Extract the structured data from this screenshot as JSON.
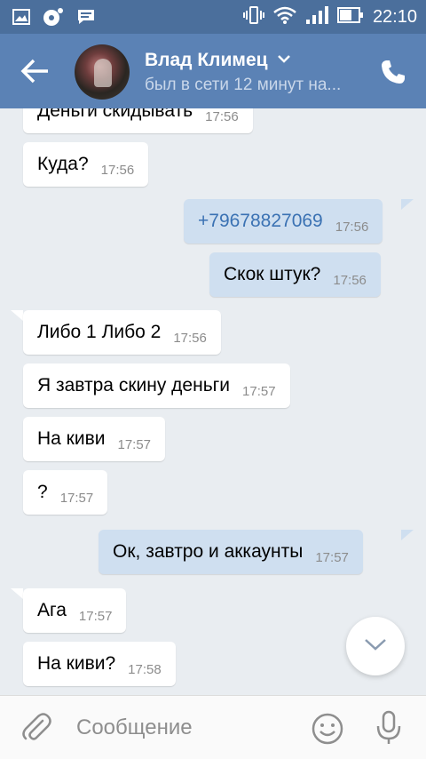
{
  "status_bar": {
    "time": "22:10",
    "icons": [
      "gallery-icon",
      "media-notification-icon",
      "chat-notification-icon",
      "vibrate-icon",
      "wifi-icon",
      "signal-icon",
      "battery-icon"
    ]
  },
  "header": {
    "contact_name": "Влад Климец",
    "last_seen": "был в сети 12 минут на...",
    "icons": [
      "back-arrow-icon",
      "chevron-down-icon",
      "phone-icon"
    ],
    "colors": {
      "header_bg": "#5b82b5",
      "statusbar_bg": "#4b6f9c"
    }
  },
  "messages": [
    {
      "direction": "in",
      "text": "Деньги скидывать",
      "time": "17:56"
    },
    {
      "direction": "in",
      "text": "Куда?",
      "time": "17:56"
    },
    {
      "direction": "out",
      "text": "+79678827069",
      "time": "17:56"
    },
    {
      "direction": "out",
      "text": "Скок штук?",
      "time": "17:56"
    },
    {
      "direction": "in",
      "text": "Либо 1 Либо 2",
      "time": "17:56"
    },
    {
      "direction": "in",
      "text": "Я завтра скину деньги",
      "time": "17:57"
    },
    {
      "direction": "in",
      "text": "На киви",
      "time": "17:57"
    },
    {
      "direction": "in",
      "text": "?",
      "time": "17:57"
    },
    {
      "direction": "out",
      "text": "Ок, завтро и аккаунты",
      "time": "17:57"
    },
    {
      "direction": "in",
      "text": "Ага",
      "time": "17:57"
    },
    {
      "direction": "in",
      "text": "На киви?",
      "time": "17:58"
    }
  ],
  "composer": {
    "placeholder": "Сообщение",
    "icons": [
      "paperclip-icon",
      "smiley-icon",
      "microphone-icon"
    ]
  },
  "colors": {
    "chat_bg": "#e9edf1",
    "incoming_bubble": "#ffffff",
    "outgoing_bubble": "#cfdff0",
    "link": "#3b72b3"
  }
}
